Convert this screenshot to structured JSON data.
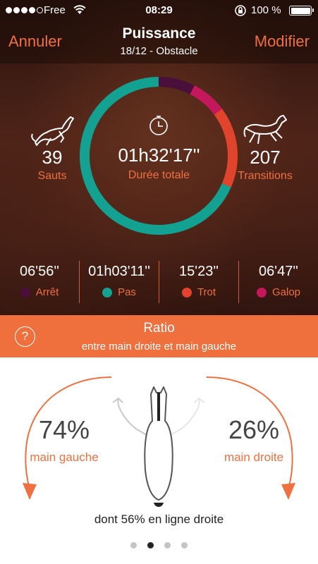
{
  "status_bar": {
    "signal_dots": 4,
    "carrier": "Free",
    "time": "08:29",
    "battery_pct": "100 %",
    "icons": [
      "wifi-icon",
      "orientation-lock-icon",
      "battery-icon"
    ]
  },
  "nav": {
    "left_label": "Annuler",
    "title": "Puissance",
    "subtitle": "18/12  - Obstacle",
    "right_label": "Modifier"
  },
  "summary": {
    "jumps": {
      "value": "39",
      "label": "Sauts",
      "icon": "jumping-horse-icon"
    },
    "total": {
      "value": "01h32'17''",
      "label": "Durée totale",
      "icon": "clock-icon"
    },
    "transitions": {
      "value": "207",
      "label": "Transitions",
      "icon": "galloping-horse-icon"
    }
  },
  "gaits": [
    {
      "time": "06'56''",
      "label": "Arrêt",
      "color": "#4a0f3a",
      "minutes": 6.93
    },
    {
      "time": "01h03'11''",
      "label": "Pas",
      "color": "#13a191",
      "minutes": 63.18
    },
    {
      "time": "15'23''",
      "label": "Trot",
      "color": "#e0442d",
      "minutes": 15.38
    },
    {
      "time": "06'47''",
      "label": "Galop",
      "color": "#c3185c",
      "minutes": 6.78
    }
  ],
  "ratio": {
    "title": "Ratio",
    "subtitle": "entre main droite et main gauche",
    "help_glyph": "?",
    "left": {
      "value": "74%",
      "label": "main gauche"
    },
    "right": {
      "value": "26%",
      "label": "main droite"
    },
    "straight": "dont 56% en ligne droite"
  },
  "pager": {
    "count": 4,
    "active_index": 1
  },
  "colors": {
    "accent": "#ef7040",
    "ratio_bar": "#ef6f3d"
  }
}
